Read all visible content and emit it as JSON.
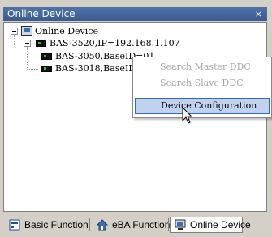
{
  "panel": {
    "title": "Online Device",
    "pin_glyph": "⨯"
  },
  "tree": {
    "root": {
      "label": "Online Device",
      "icon": "computer-icon"
    },
    "controller": {
      "label": "BAS-3520,IP=192.168.1.107",
      "icon": "controller-icon"
    },
    "children": [
      {
        "label": "BAS-3050,BaseID=01",
        "icon": "module-icon"
      },
      {
        "label": "BAS-3018,BaseID",
        "icon": "module-icon"
      }
    ]
  },
  "context_menu": {
    "items": [
      {
        "label": "Search Master DDC",
        "enabled": false
      },
      {
        "label": "Search Slave DDC",
        "enabled": false
      },
      {
        "label": "Device Configuration",
        "enabled": true,
        "highlighted": true
      }
    ]
  },
  "tabs": [
    {
      "label": "Basic Function",
      "icon": "basic-function-icon"
    },
    {
      "label": "eBA Function",
      "icon": "house-icon"
    },
    {
      "label": "Online Device",
      "icon": "computer-icon",
      "active": true
    }
  ],
  "colors": {
    "titlebar": "#3a5a92",
    "menu_highlight": "#c1d2ee",
    "menu_highlight_border": "#316ac5"
  }
}
